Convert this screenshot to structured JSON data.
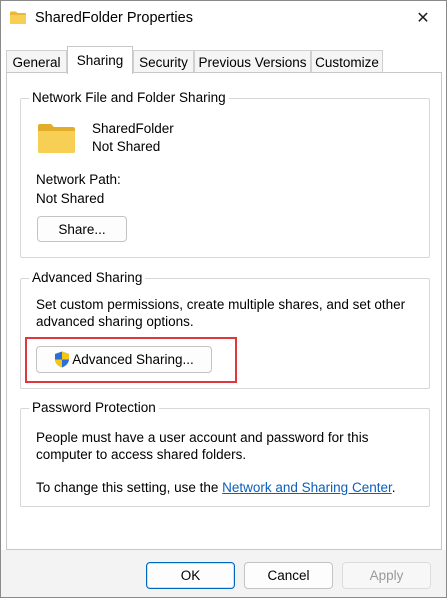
{
  "window": {
    "title": "SharedFolder Properties",
    "close_glyph": "✕"
  },
  "tabs": [
    {
      "label": "General"
    },
    {
      "label": "Sharing",
      "active": true
    },
    {
      "label": "Security"
    },
    {
      "label": "Previous Versions"
    },
    {
      "label": "Customize"
    }
  ],
  "network_sharing": {
    "group_title": "Network File and Folder Sharing",
    "folder_name": "SharedFolder",
    "folder_status": "Not Shared",
    "path_label": "Network Path:",
    "path_value": "Not Shared",
    "share_button": "Share..."
  },
  "advanced_sharing": {
    "group_title": "Advanced Sharing",
    "description": "Set custom permissions, create multiple shares, and set other advanced sharing options.",
    "button": "Advanced Sharing..."
  },
  "password_protection": {
    "group_title": "Password Protection",
    "description": "People must have a user account and password for this computer to access shared folders.",
    "change_prefix": "To change this setting, use the ",
    "link_text": "Network and Sharing Center",
    "change_suffix": "."
  },
  "footer": {
    "ok": "OK",
    "cancel": "Cancel",
    "apply": "Apply"
  },
  "colors": {
    "folder": "#f4c542",
    "highlight": "#e0373f",
    "link": "#0b5fbd",
    "accent": "#0067c0"
  }
}
